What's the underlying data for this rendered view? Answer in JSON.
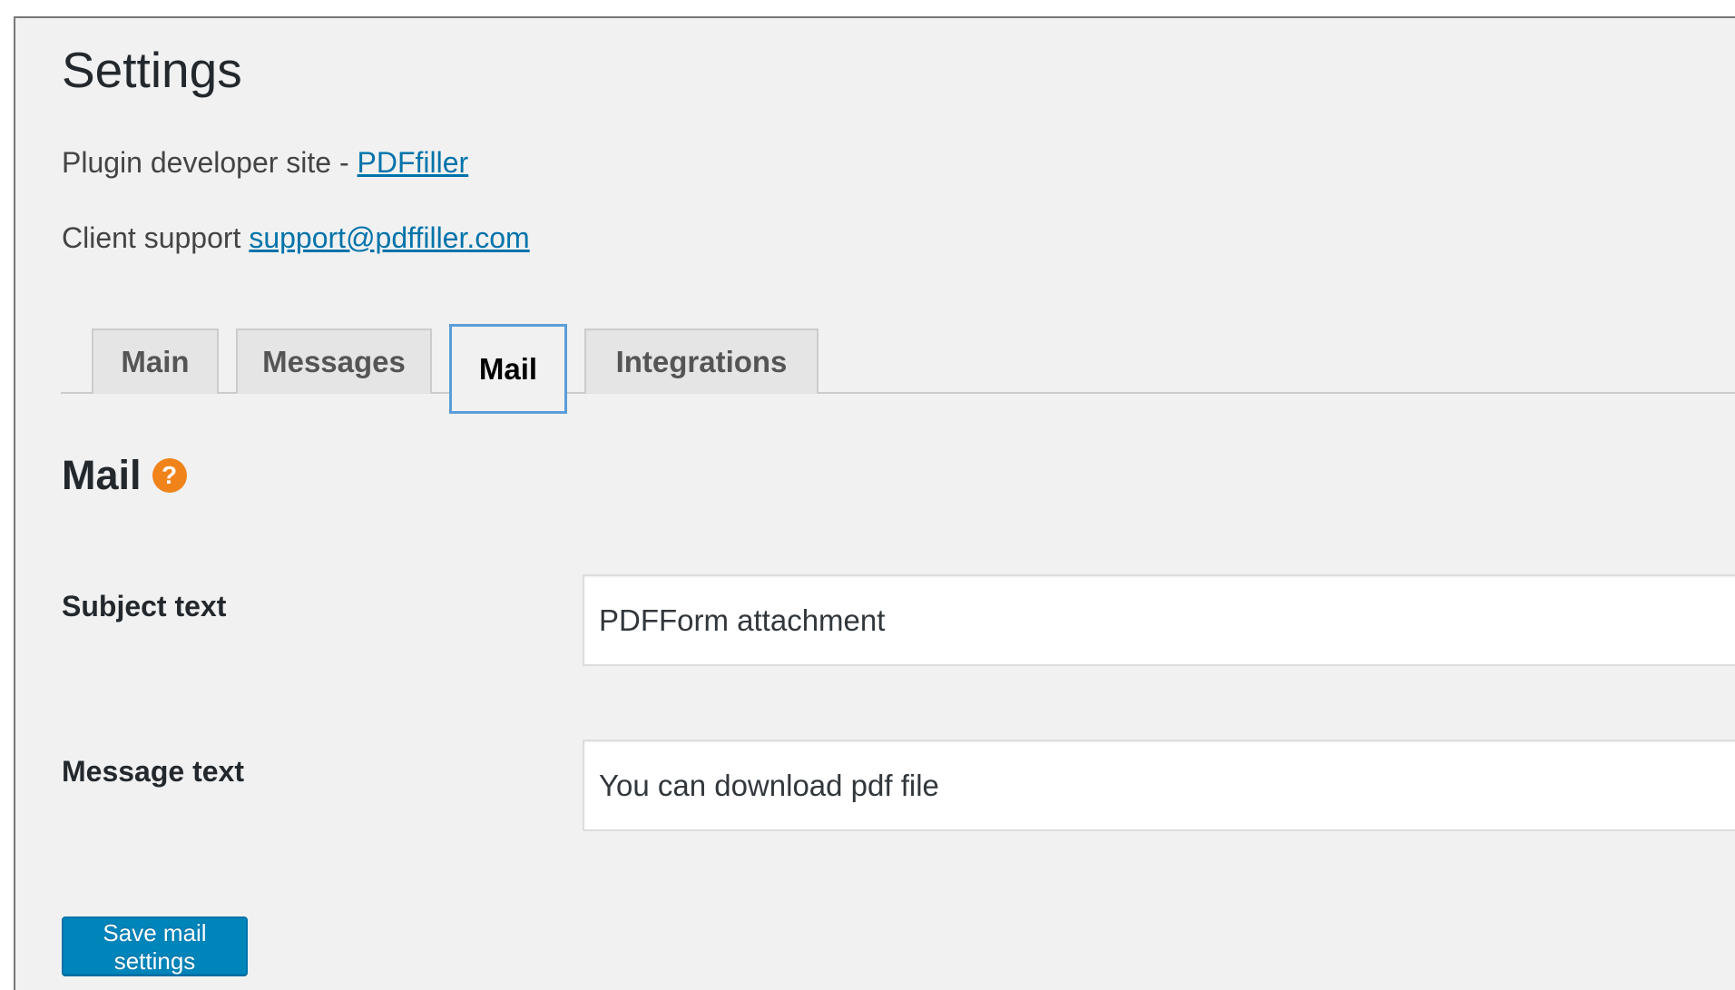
{
  "page": {
    "title": "Settings"
  },
  "info": {
    "developer_prefix": "Plugin developer site - ",
    "developer_link": "PDFfiller",
    "support_prefix": "Client support ",
    "support_link": "support@pdffiller.com"
  },
  "tabs": [
    {
      "label": "Main",
      "active": false
    },
    {
      "label": "Messages",
      "active": false
    },
    {
      "label": "Mail",
      "active": true
    },
    {
      "label": "Integrations",
      "active": false
    }
  ],
  "section": {
    "title": "Mail",
    "help_icon": "question-circle-icon",
    "help_glyph": "?"
  },
  "fields": {
    "subject": {
      "label": "Subject text",
      "value": "PDFForm attachment"
    },
    "message": {
      "label": "Message text",
      "value": "You can download pdf file"
    }
  },
  "actions": {
    "save_label": "Save mail settings"
  },
  "colors": {
    "accent": "#0085ba",
    "link": "#0073aa",
    "help_icon": "#f0831a",
    "active_tab_border": "#5b9dd9",
    "background": "#f1f1f1"
  }
}
